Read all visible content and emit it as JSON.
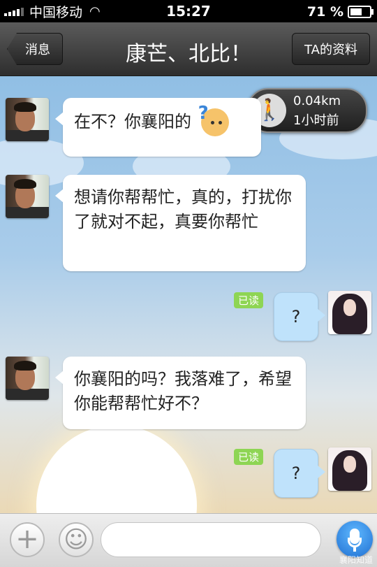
{
  "status_bar": {
    "carrier": "中国移动",
    "time": "15:27",
    "battery": "71 %",
    "battery_level": 0.71
  },
  "nav": {
    "back_label": "消息",
    "title": "康芒、北比！",
    "profile_label": "TA的资料"
  },
  "location": {
    "distance": "0.04km",
    "time_ago": "1小时前"
  },
  "messages": [
    {
      "side": "left",
      "text": "在不？你襄阳的",
      "emoji": "?"
    },
    {
      "side": "left",
      "text": "想请你帮帮忙，真的，打扰你了就对不起，真要你帮忙"
    },
    {
      "side": "right",
      "text": "?",
      "read": "已读"
    },
    {
      "side": "left",
      "text": "你襄阳的吗？我落难了，希望你能帮帮忙好不？"
    },
    {
      "side": "right",
      "text": "?",
      "read": "已读"
    }
  ],
  "input": {
    "plus": "+",
    "placeholder": ""
  },
  "watermark": "襄阳知道"
}
